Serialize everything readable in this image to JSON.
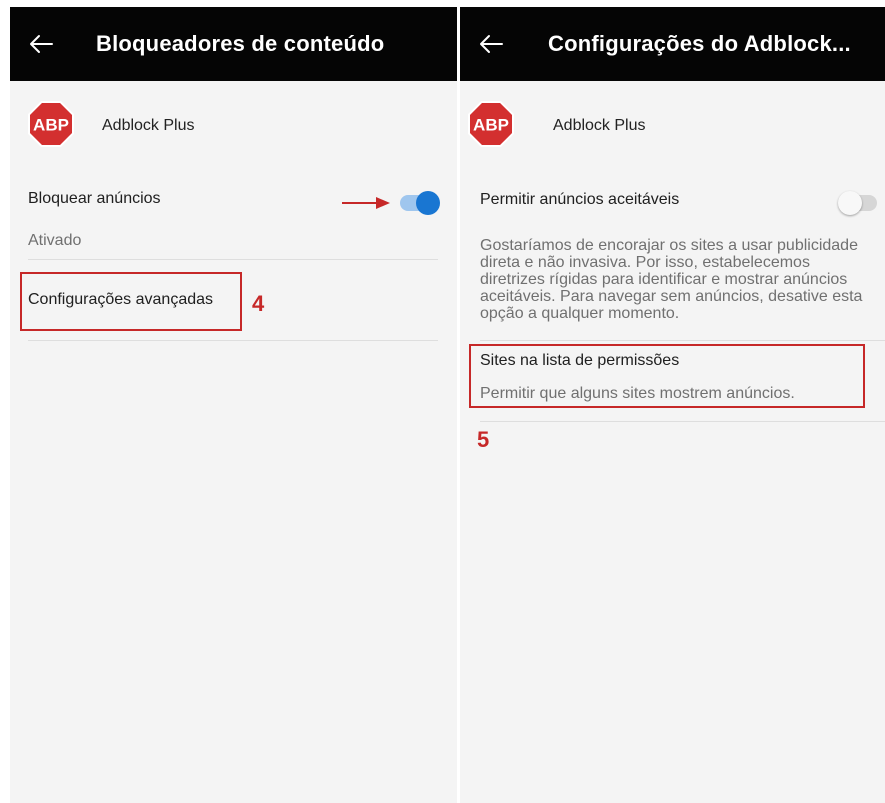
{
  "colors": {
    "appbar": "#050505",
    "accent": "#1976d2",
    "annotation": "#c62828",
    "abp_red": "#d32f2f"
  },
  "left_screen": {
    "appbar": {
      "back_icon": "arrow-left-icon",
      "title": "Bloqueadores de conteúdo"
    },
    "app": {
      "logo_text": "ABP",
      "name": "Adblock Plus"
    },
    "block_ads": {
      "label": "Bloquear anúncios",
      "status": "Ativado",
      "toggle_on": true
    },
    "advanced_settings": {
      "label": "Configurações avançadas"
    },
    "step_number": "4"
  },
  "right_screen": {
    "appbar": {
      "back_icon": "arrow-left-icon",
      "title": "Configurações do Adblock..."
    },
    "app": {
      "logo_text": "ABP",
      "name": "Adblock Plus"
    },
    "acceptable_ads": {
      "label": "Permitir anúncios aceitáveis",
      "toggle_on": false,
      "description_lines": [
        "Gostaríamos de encorajar os sites a usar publicidade",
        "direta e não invasiva. Por isso, estabelecemos",
        "diretrizes rígidas para identificar e mostrar anúncios",
        "aceitáveis. Para navegar sem anúncios, desative esta",
        "opção a qualquer momento."
      ]
    },
    "whitelist": {
      "label": "Sites na lista de permissões",
      "description": "Permitir que alguns sites mostrem anúncios."
    },
    "step_number": "5"
  }
}
